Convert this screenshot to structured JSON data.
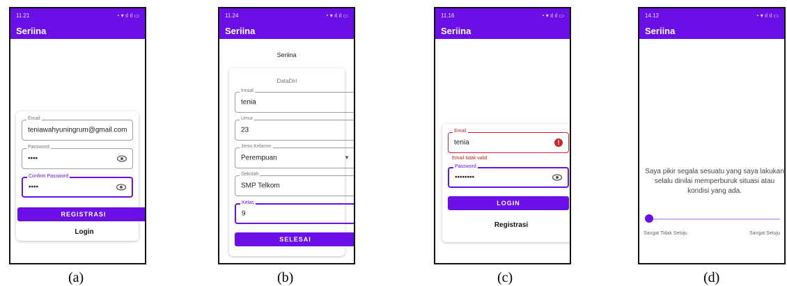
{
  "app_title": "Seriina",
  "icons": [
    "visibility-icon",
    "dropdown-arrow-icon",
    "error-icon",
    "wifi-icon",
    "signal-icon",
    "battery-icon"
  ],
  "colors": {
    "primary": "#6a0fe6",
    "error": "#c62828"
  },
  "screens": [
    {
      "caption": "(a)",
      "status_time": "11.21",
      "fields": [
        {
          "label": "Email",
          "value": "teniawahyuningrum@gmail.com"
        },
        {
          "label": "Password",
          "value": "••••"
        },
        {
          "label": "Confirm Password",
          "value": "••••"
        }
      ],
      "button": "REGISTRASI",
      "link": "Login"
    },
    {
      "caption": "(b)",
      "status_time": "11.24",
      "heading": "Seriina",
      "card_title": "DataDiri",
      "fields": [
        {
          "label": "Inisial",
          "value": "tenia"
        },
        {
          "label": "Umur",
          "value": "23"
        },
        {
          "label": "Jenis Kelamin",
          "value": "Perempuan"
        },
        {
          "label": "Sekolah",
          "value": "SMP Telkom"
        },
        {
          "label": "Kelas",
          "value": "9"
        }
      ],
      "button": "SELESAI"
    },
    {
      "caption": "(c)",
      "status_time": "11.16",
      "fields": [
        {
          "label": "Email",
          "value": "tenia",
          "error": "Email tidak valid"
        },
        {
          "label": "Password",
          "value": "••••••••"
        }
      ],
      "button": "LOGIN",
      "link": "Registrasi"
    },
    {
      "caption": "(d)",
      "status_time": "14.12",
      "question": "Saya pikir segala sesuatu yang saya lakukan selalu dinilai memperburuk situasi atau kondisi yang ada.",
      "slider_min_label": "Sangat Tidak Setuju",
      "slider_max_label": "Sangat Setuju"
    }
  ]
}
